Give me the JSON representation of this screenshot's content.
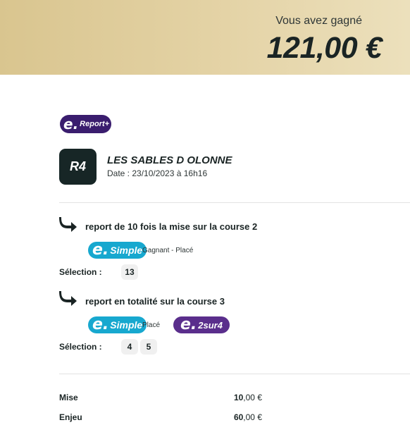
{
  "header": {
    "win_label": "Vous avez gagné",
    "win_amount": "121,00 €"
  },
  "bet_badge": {
    "e": "e.",
    "label": "Report+"
  },
  "race": {
    "code": "R4",
    "name": "LES SABLES D OLONNE",
    "date": "Date : 23/10/2023 à 16h16"
  },
  "steps": [
    {
      "title": "report de 10 fois la mise sur la course 2",
      "bets": [
        {
          "e": "e.",
          "label": "Simple",
          "desc": "Gagnant - Placé"
        }
      ],
      "selection_label": "Sélection :",
      "selection": [
        "13"
      ]
    },
    {
      "title": "report en totalité sur la course 3",
      "bets": [
        {
          "e": "e.",
          "label": "Simple",
          "desc": "Placé"
        },
        {
          "e": "e.",
          "label": "2sur4"
        }
      ],
      "selection_label": "Sélection :",
      "selection": [
        "4",
        "5"
      ]
    }
  ],
  "summary": {
    "mise": {
      "label": "Mise",
      "int": "10",
      "dec": ",00 €"
    },
    "enjeu": {
      "label": "Enjeu",
      "int": "60",
      "dec": ",00 €"
    }
  },
  "colors": {
    "banner": "#e4d3a6",
    "tile": "#172626",
    "esimple": "#17a8cf",
    "purple": "#5a2e8c",
    "report": "#3a1d6e"
  }
}
